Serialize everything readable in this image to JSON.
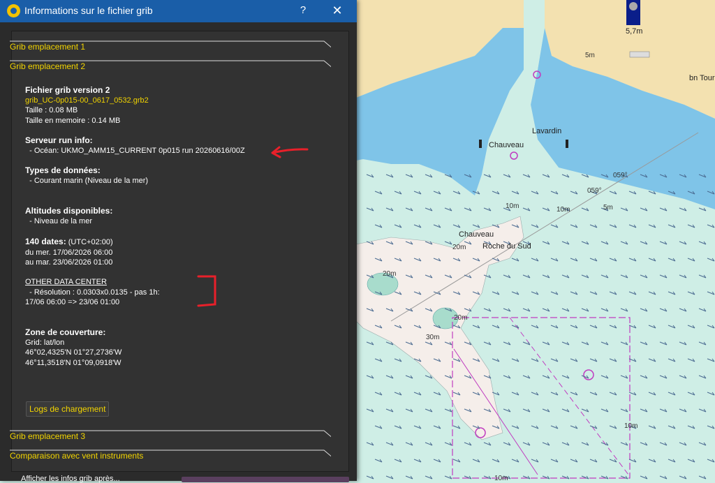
{
  "window": {
    "title": "Informations sur le fichier grib",
    "help_label": "?",
    "close_label": "✕"
  },
  "sections": {
    "grib1": "Grib emplacement 1",
    "grib2": "Grib emplacement 2",
    "grib3": "Grib emplacement 3",
    "comparaison": "Comparaison avec vent instruments"
  },
  "file": {
    "heading": "Fichier grib version 2",
    "name": "grib_UC-0p015-00_0617_0532.grb2",
    "size": "Taille : 0.08 MB",
    "memory": "Taille en memoire : 0.14 MB"
  },
  "server": {
    "heading": "Serveur run info:",
    "ocean": "  - Océan: UKMO_AMM15_CURRENT 0p015 run 20260616/00Z"
  },
  "types": {
    "heading": "Types de données:",
    "item": "  - Courant marin (Niveau de la mer)"
  },
  "altitudes": {
    "heading": "Altitudes disponibles:",
    "item": "  - Niveau de la mer"
  },
  "dates": {
    "count": "140 dates:",
    "tz": " (UTC+02:00)",
    "from": "du mer. 17/06/2026 06:00",
    "to": "au mar. 23/06/2026 01:00"
  },
  "datacenter": {
    "heading": "OTHER DATA CENTER",
    "resolution": "  - Résolution : 0.0303x0.0135 - pas 1h:",
    "range": "17/06 06:00 => 23/06 01:00"
  },
  "coverage": {
    "heading": "Zone de couverture:",
    "grid": "Grid: lat/lon",
    "corner1": "46°02,4325'N 01°27,2736'W",
    "corner2": "46°11,3518'N 01°09,0918'W"
  },
  "logs_button": "Logs de chargement",
  "bottom_text": "Afficher les infos grib après...",
  "map": {
    "buoy_label": "5,7m",
    "labels": {
      "chauveau1": "Chauveau",
      "chauveau2": "Chauveau",
      "lavardin": "Lavardin",
      "roche": "Roche du Sud",
      "bntour": "bn Tour",
      "d5m": "5m",
      "d5m2": "5m",
      "d10m1": "10m",
      "d10m2": "10m",
      "d10m3": "10m",
      "d10m4": "10m",
      "d20m1": "20m",
      "d20m2": "20m",
      "d20m3": "20m",
      "d30m": "30m",
      "b059a": "059°",
      "b059b": "059°"
    },
    "colors": {
      "land": "#f3e1b0",
      "shallow": "#7fc4e8",
      "water": "#cfeee6",
      "dry": "#f5eeea",
      "magenta": "#c03cc0"
    }
  }
}
